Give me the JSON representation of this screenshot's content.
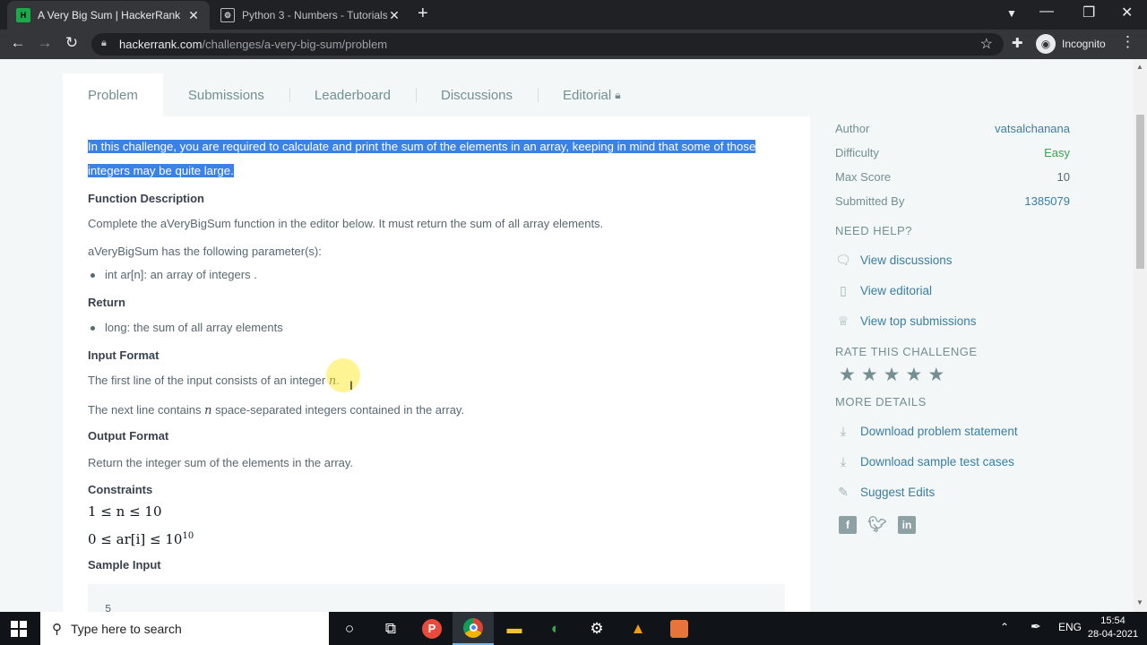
{
  "browser": {
    "tabs": [
      {
        "title": "A Very Big Sum | HackerRank",
        "active": true
      },
      {
        "title": "Python 3 - Numbers - Tutorialsp",
        "active": false
      }
    ],
    "url_host": "hackerrank.com",
    "url_path": "/challenges/a-very-big-sum/problem",
    "profile_label": "Incognito"
  },
  "page": {
    "tabs": [
      "Problem",
      "Submissions",
      "Leaderboard",
      "Discussions",
      "Editorial"
    ],
    "intro": "In this challenge, you are required to calculate and print the sum of the elements in an array, keeping in mind that some of those integers may be quite large.",
    "function_description_heading": "Function Description",
    "function_description": "Complete the aVeryBigSum function in the editor below. It must return the sum of all array elements.",
    "params_intro": "aVeryBigSum has the following parameter(s):",
    "param_1": "int ar[n]: an array of integers .",
    "return_heading": "Return",
    "return_1": "long: the sum of all array elements",
    "input_format_heading": "Input Format",
    "input_line_1_pre": "The first line of the input consists of an integer",
    "input_line_1_var": "n",
    "input_line_1_post": ".",
    "input_line_2_pre": "The next line contains",
    "input_line_2_var": "n",
    "input_line_2_post": "space-separated integers contained in the array.",
    "output_format_heading": "Output Format",
    "output_format": "Return the integer sum of the elements in the array.",
    "constraints_heading": "Constraints",
    "constraint_1": "1 ≤ n ≤ 10",
    "constraint_2_base": "0 ≤ ar[i] ≤ 10",
    "constraint_2_exp": "10",
    "sample_input_heading": "Sample Input",
    "sample_input_first": "5"
  },
  "sidebar": {
    "author_label": "Author",
    "author": "vatsalchanana",
    "difficulty_label": "Difficulty",
    "difficulty": "Easy",
    "max_score_label": "Max Score",
    "max_score": "10",
    "submitted_by_label": "Submitted By",
    "submitted_by": "1385079",
    "need_help": "NEED HELP?",
    "help_links": [
      "View discussions",
      "View editorial",
      "View top submissions"
    ],
    "rate_heading": "RATE THIS CHALLENGE",
    "more_details": "MORE DETAILS",
    "detail_links": [
      "Download problem statement",
      "Download sample test cases",
      "Suggest Edits"
    ]
  },
  "taskbar": {
    "search_placeholder": "Type here to search",
    "language": "ENG",
    "time": "15:54",
    "date": "28-04-2021"
  }
}
